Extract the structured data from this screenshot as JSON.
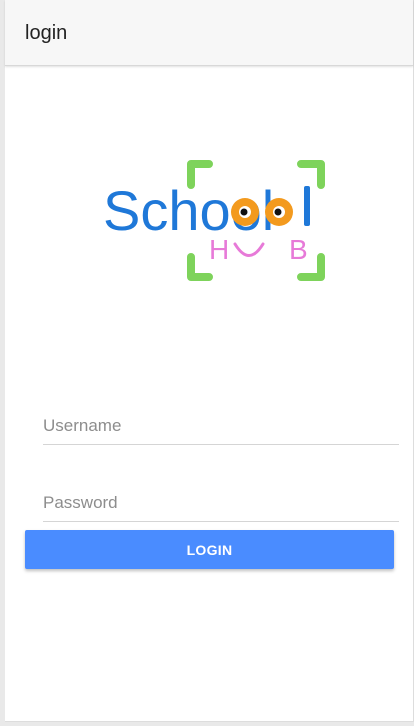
{
  "app_bar": {
    "title": "login"
  },
  "logo": {
    "icon": "school-hub-logo",
    "word_top": "School",
    "word_bottom_left": "H",
    "word_bottom_right": "B",
    "colors": {
      "blue": "#1f78d8",
      "orange": "#f39a1e",
      "green": "#7ed35b",
      "pink": "#e77ad8"
    }
  },
  "form": {
    "username": {
      "placeholder": "Username",
      "value": ""
    },
    "password": {
      "placeholder": "Password",
      "value": ""
    },
    "login_label": "LOGIN"
  },
  "colors": {
    "accent": "#4a8cff",
    "app_bar": "#f7f7f7"
  }
}
